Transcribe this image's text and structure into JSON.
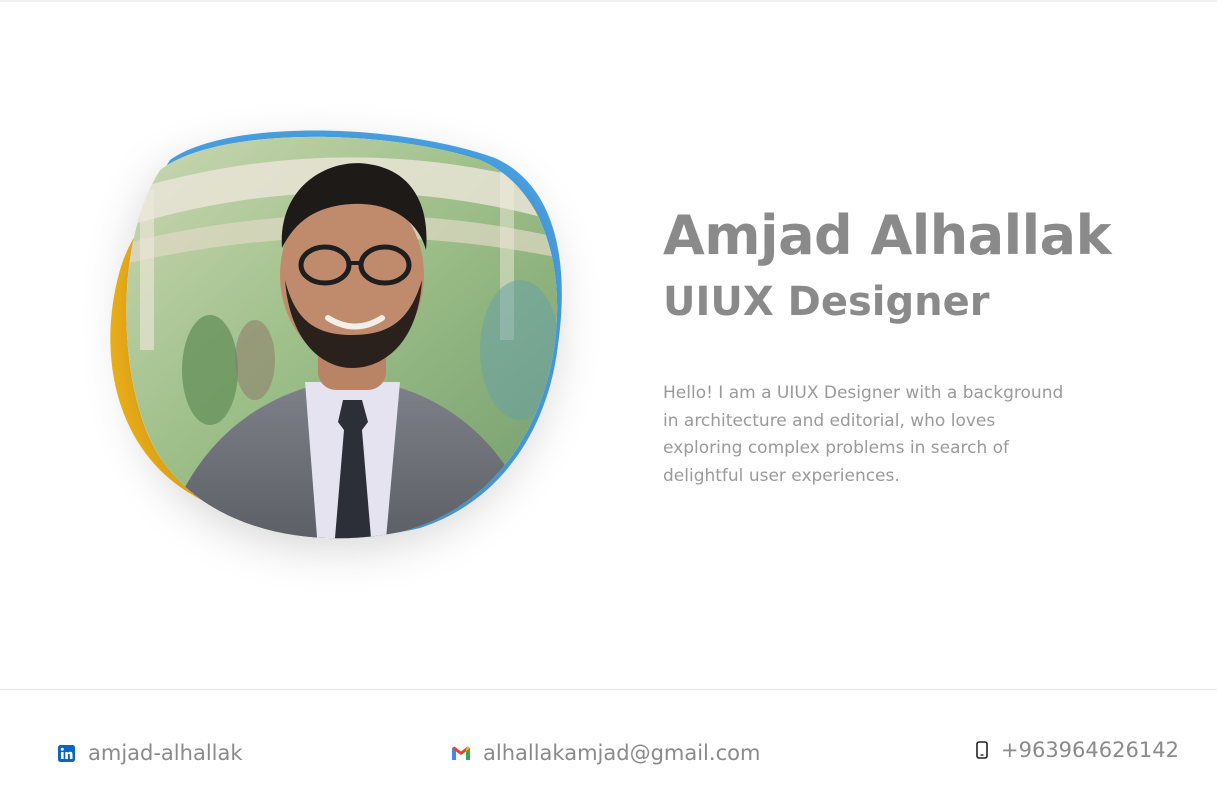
{
  "profile": {
    "name": "Amjad Alhallak",
    "role": "UIUX Designer",
    "bio": "Hello! I am a UIUX Designer with a background in architecture and editorial, who loves exploring complex problems in search of delightful user experiences."
  },
  "contacts": {
    "linkedin": {
      "label": "amjad-alhallak",
      "icon": "linkedin-icon"
    },
    "email": {
      "label": "alhallakamjad@gmail.com",
      "icon": "gmail-icon"
    },
    "phone": {
      "label": "+963964626142",
      "icon": "mobile-phone-icon"
    }
  },
  "colors": {
    "text_gray": "#8a8a8a",
    "bio_gray": "#9a9a9a",
    "blob_blue": "#4aa3e6",
    "blob_yellow": "#f2b31a",
    "linkedin_blue": "#0a66c2"
  }
}
